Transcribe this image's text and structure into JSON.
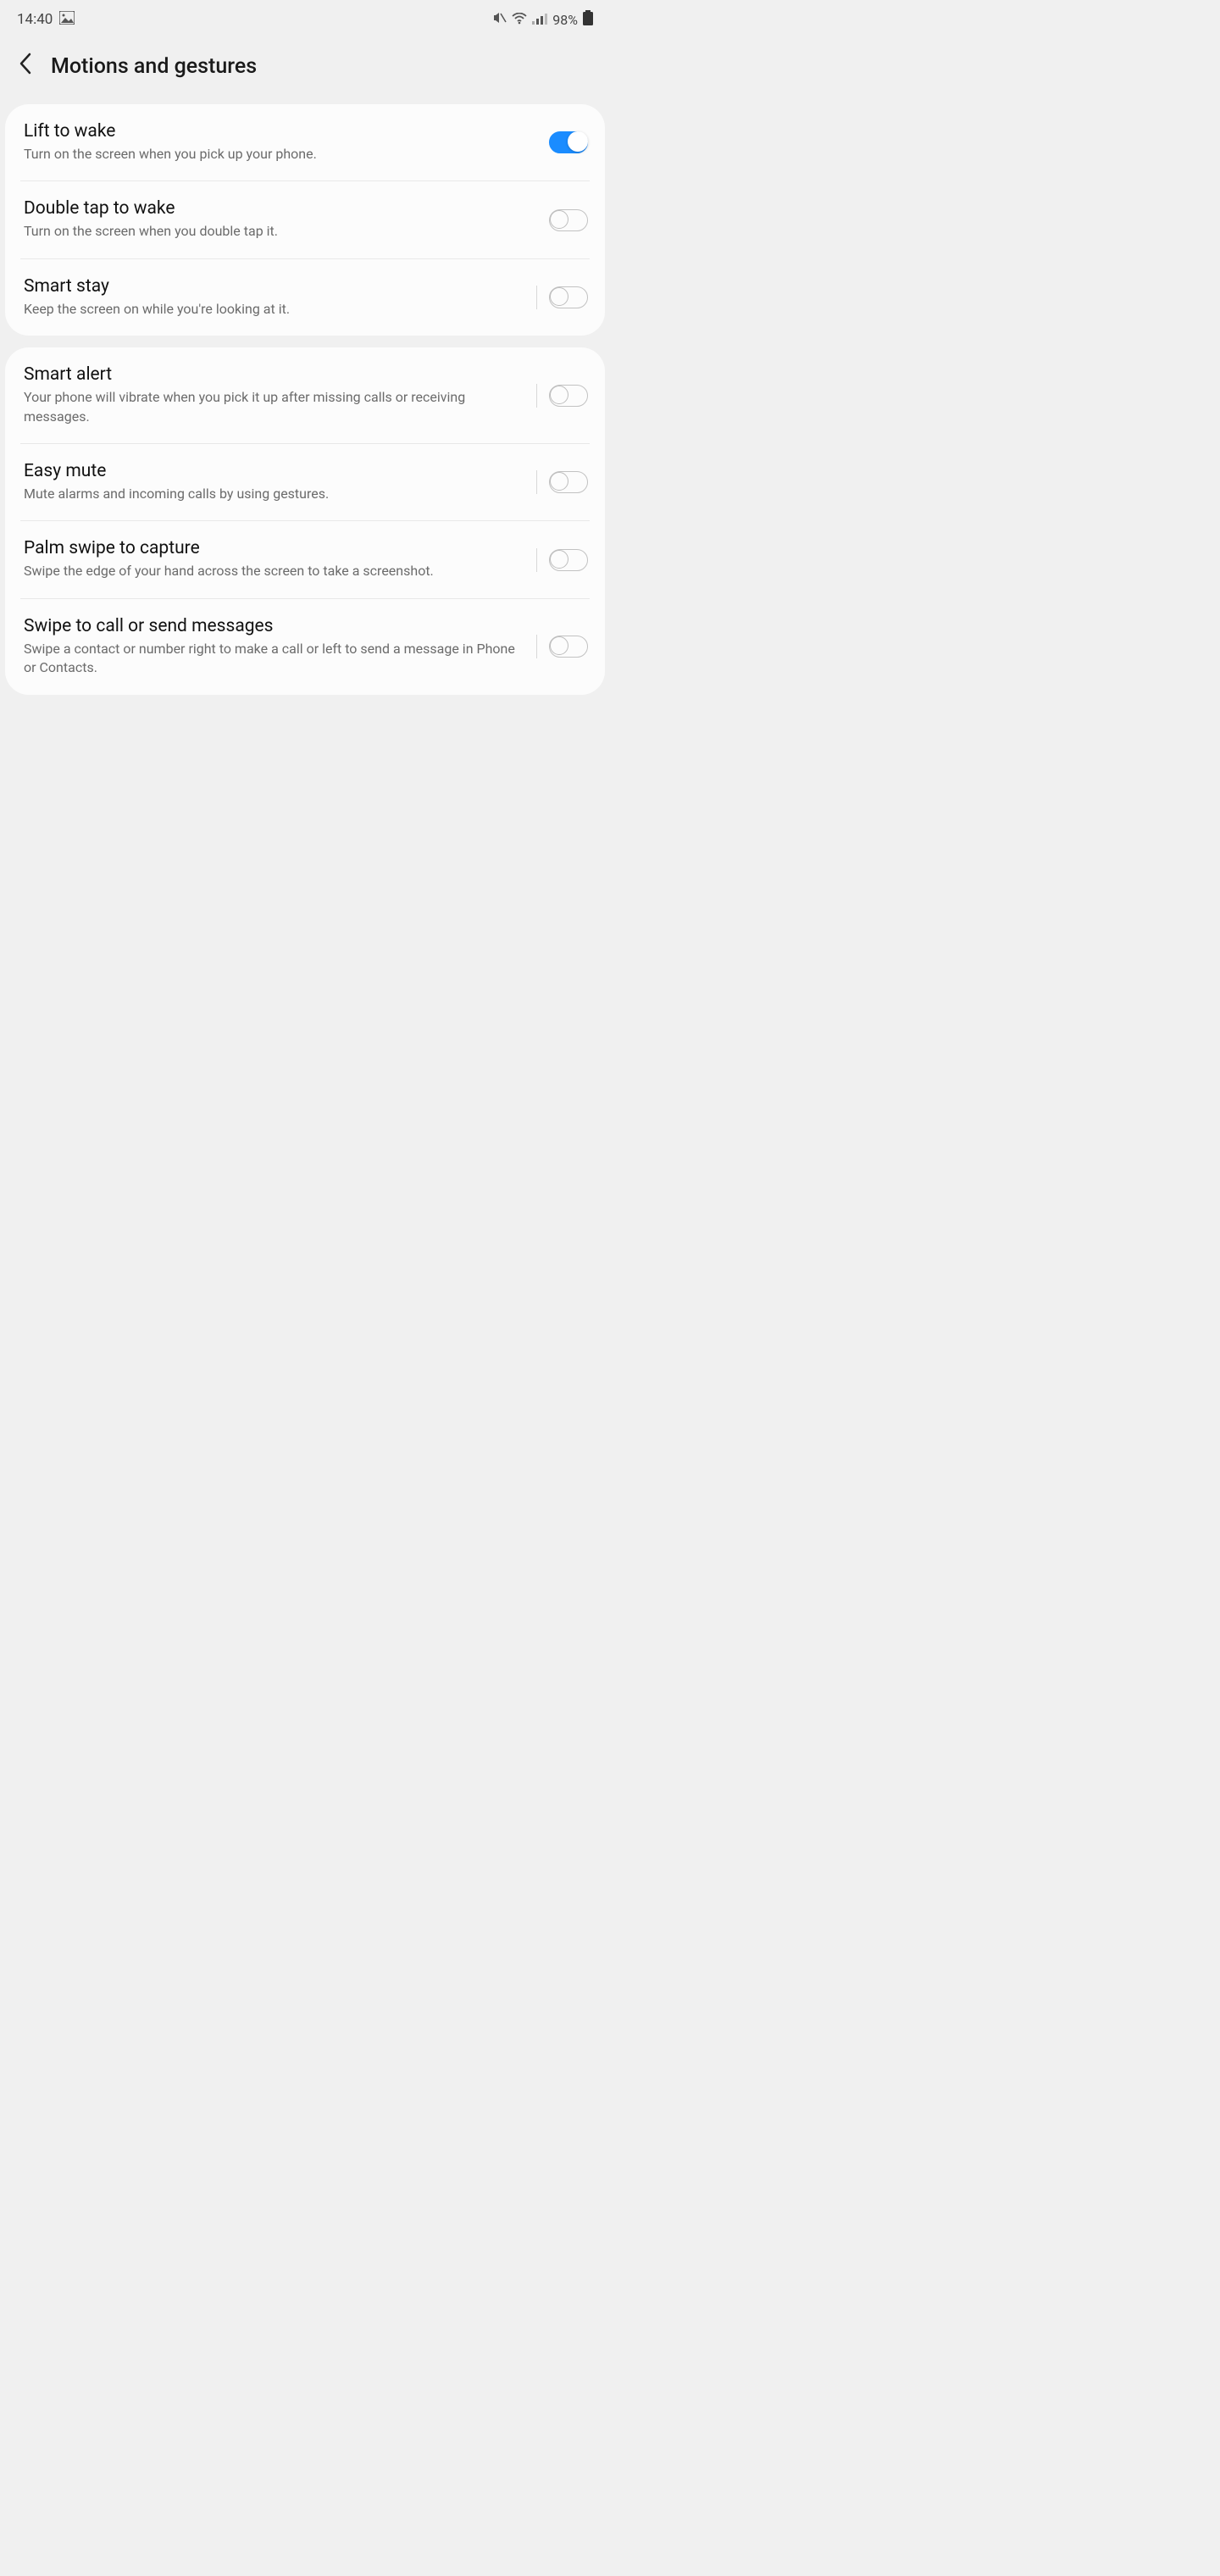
{
  "status": {
    "time": "14:40",
    "battery_text": "98%"
  },
  "header": {
    "title": "Motions and gestures"
  },
  "groups": [
    {
      "rows": [
        {
          "id": "lift-to-wake",
          "title": "Lift to wake",
          "desc": "Turn on the screen when you pick up your phone.",
          "on": true,
          "separator": false
        },
        {
          "id": "double-tap-to-wake",
          "title": "Double tap to wake",
          "desc": "Turn on the screen when you double tap it.",
          "on": false,
          "separator": false
        },
        {
          "id": "smart-stay",
          "title": "Smart stay",
          "desc": "Keep the screen on while you're looking at it.",
          "on": false,
          "separator": true
        }
      ]
    },
    {
      "rows": [
        {
          "id": "smart-alert",
          "title": "Smart alert",
          "desc": "Your phone will vibrate when you pick it up after missing calls or receiving messages.",
          "on": false,
          "separator": true
        },
        {
          "id": "easy-mute",
          "title": "Easy mute",
          "desc": "Mute alarms and incoming calls by using gestures.",
          "on": false,
          "separator": true
        },
        {
          "id": "palm-swipe",
          "title": "Palm swipe to capture",
          "desc": "Swipe the edge of your hand across the screen to take a screenshot.",
          "on": false,
          "separator": true
        },
        {
          "id": "swipe-to-call",
          "title": "Swipe to call or send messages",
          "desc": "Swipe a contact or number right to make a call or left to send a message in Phone or Contacts.",
          "on": false,
          "separator": true
        }
      ]
    }
  ]
}
